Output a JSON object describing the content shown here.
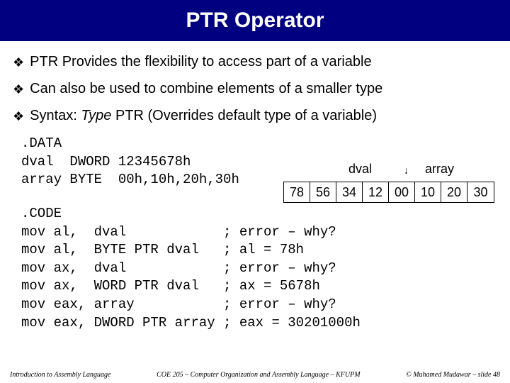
{
  "title": "PTR Operator",
  "bullets": {
    "b1": "PTR Provides the flexibility to access part of a variable",
    "b2": "Can also be used to combine elements of a smaller type",
    "b3_prefix": "Syntax: ",
    "b3_italic": "Type",
    "b3_rest": " PTR (Overrides default type of a variable)"
  },
  "data_block": ".DATA\ndval  DWORD 12345678h\narray BYTE  00h,10h,20h,30h",
  "code_block": ".CODE\nmov al,  dval            ; error – why?\nmov al,  BYTE PTR dval   ; al = 78h\nmov ax,  dval            ; error – why?\nmov ax,  WORD PTR dval   ; ax = 5678h\nmov eax, array           ; error – why?\nmov eax, DWORD PTR array ; eax = 30201000h",
  "mem": {
    "label_dval": "dval",
    "label_array": "array",
    "cells": [
      "78",
      "56",
      "34",
      "12",
      "00",
      "10",
      "20",
      "30"
    ]
  },
  "footer": {
    "left": "Introduction to Assembly Language",
    "center": "COE 205 – Computer Organization and Assembly Language – KFUPM",
    "right": "© Muhamed Mudawar – slide 48"
  }
}
